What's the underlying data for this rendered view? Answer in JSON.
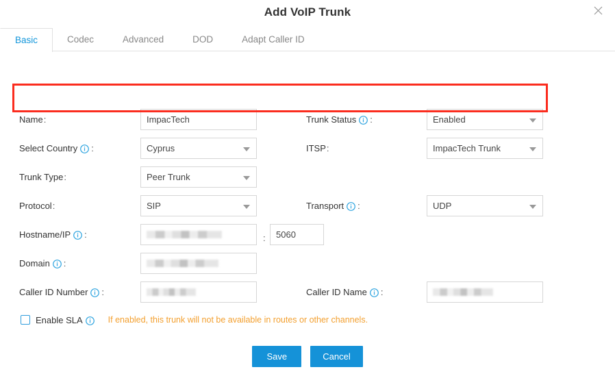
{
  "dialog": {
    "title": "Add VoIP Trunk",
    "close_icon": "close-icon"
  },
  "tabs": [
    {
      "label": "Basic",
      "active": true
    },
    {
      "label": "Codec",
      "active": false
    },
    {
      "label": "Advanced",
      "active": false
    },
    {
      "label": "DOD",
      "active": false
    },
    {
      "label": "Adapt Caller ID",
      "active": false
    }
  ],
  "fields": {
    "name": {
      "label": "Name",
      "colon": ":",
      "value": "ImpacTech",
      "type": "text",
      "has_info": false
    },
    "trunk_status": {
      "label": "Trunk Status",
      "colon": ":",
      "value": "Enabled",
      "type": "select",
      "has_info": true
    },
    "select_country": {
      "label": "Select Country",
      "colon": ":",
      "value": "Cyprus",
      "type": "select",
      "has_info": true
    },
    "itsp": {
      "label": "ITSP",
      "colon": ":",
      "value": "ImpacTech Trunk",
      "type": "select",
      "has_info": false
    },
    "trunk_type": {
      "label": "Trunk Type",
      "colon": ":",
      "value": "Peer Trunk",
      "type": "select",
      "has_info": false
    },
    "protocol": {
      "label": "Protocol",
      "colon": ":",
      "value": "SIP",
      "type": "select",
      "has_info": false
    },
    "transport": {
      "label": "Transport",
      "colon": ":",
      "value": "UDP",
      "type": "select",
      "has_info": true
    },
    "hostname_ip": {
      "label": "Hostname/IP",
      "colon": ":",
      "value": "",
      "redacted": true,
      "type": "text",
      "has_info": true
    },
    "port": {
      "label": "",
      "colon": "",
      "value": "5060",
      "type": "text",
      "has_info": false
    },
    "port_separator": ":",
    "domain": {
      "label": "Domain",
      "colon": ":",
      "value": "",
      "redacted": true,
      "type": "text",
      "has_info": true
    },
    "caller_id_number": {
      "label": "Caller ID Number",
      "colon": ":",
      "value": "",
      "redacted": true,
      "type": "text",
      "has_info": true
    },
    "caller_id_name": {
      "label": "Caller ID Name",
      "colon": ":",
      "value": "",
      "redacted": true,
      "type": "text",
      "has_info": true
    },
    "enable_sla": {
      "label": "Enable SLA",
      "checked": false,
      "has_info": true,
      "hint": "If enabled, this trunk will not be available in routes or other channels."
    }
  },
  "footer": {
    "save_label": "Save",
    "cancel_label": "Cancel"
  },
  "colors": {
    "accent": "#1296db",
    "button": "#1592d8",
    "highlight": "#fb2c1e",
    "hint": "#f3a030",
    "info_icon": "#30a5e0"
  }
}
